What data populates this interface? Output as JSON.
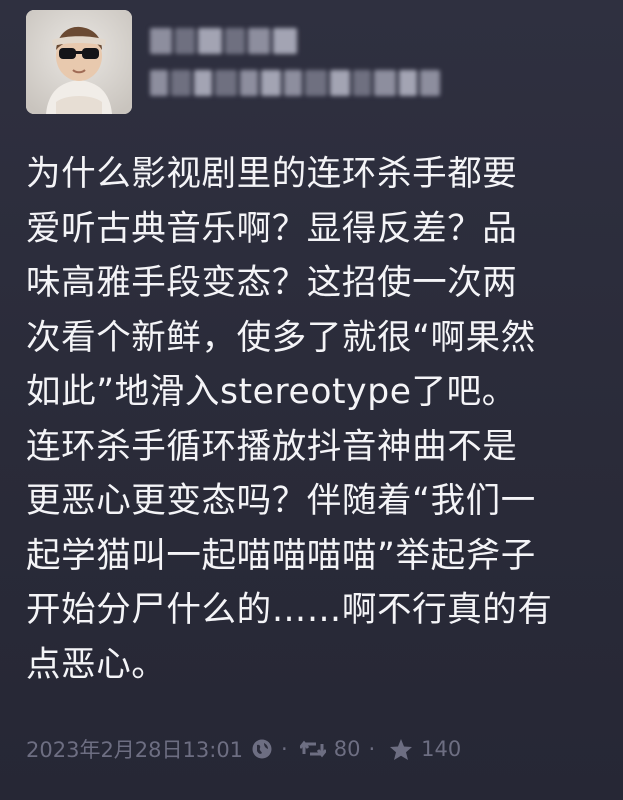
{
  "tweet": {
    "lines": [
      "为什么影视剧里的连环杀手都要",
      "爱听古典音乐啊？显得反差？品",
      "味高雅手段变态？这招使一次两",
      "次看个新鲜，使多了就很“啊果然",
      "如此”地滑入stereotype了吧。",
      "连环杀手循环播放抖音神曲不是",
      "更恶心更变态吗？伴随着“我们一",
      "起学猫叫一起喵喵喵喵”举起斧子",
      "开始分尸什么的……啊不行真的有",
      "点恶心。"
    ]
  },
  "meta": {
    "timestamp": "2023年2月28日13:01",
    "separator": "·",
    "visibility_icon": "globe-icon",
    "retweet_icon": "retweet-icon",
    "retweets": "80",
    "favorite_icon": "star-icon",
    "favorites": "140"
  },
  "colors": {
    "background": "#2b2c3b",
    "text": "#f4f4f7",
    "meta_text": "#6d6e82"
  }
}
